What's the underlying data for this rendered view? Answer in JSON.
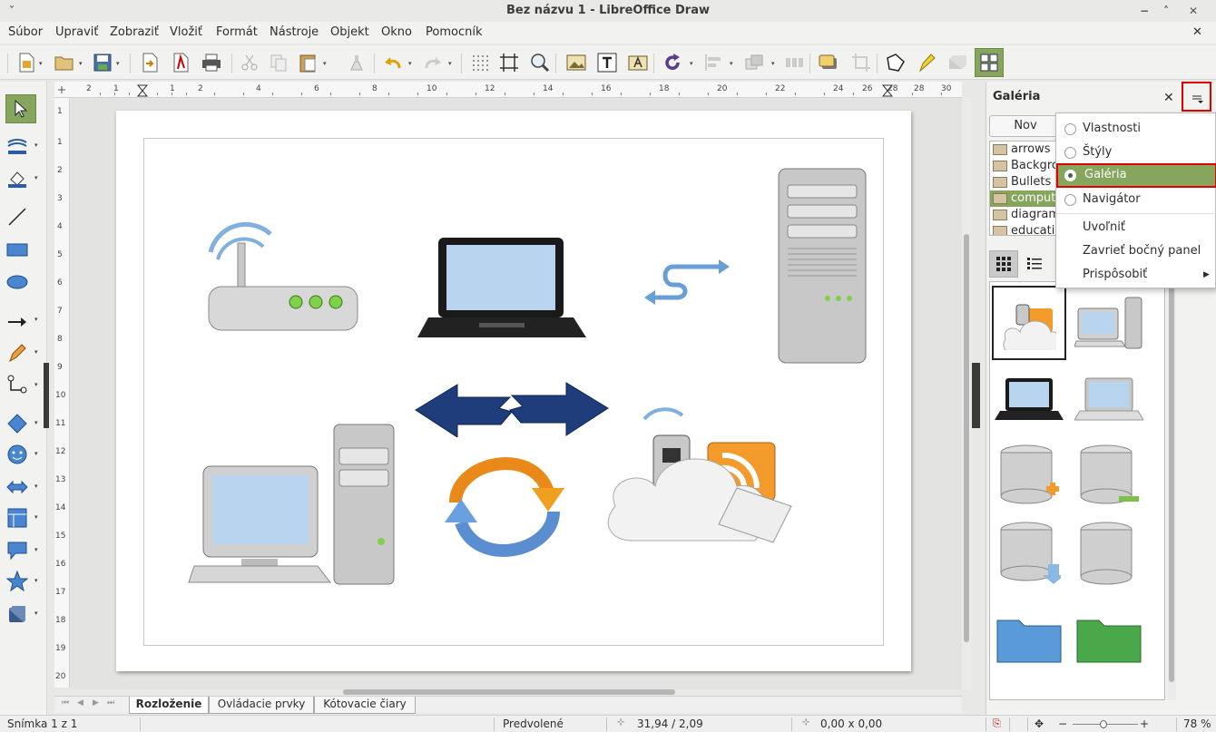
{
  "window": {
    "title": "Bez názvu 1 - LibreOffice Draw",
    "collapse_glyph": "ˇ",
    "minimize_glyph": "−",
    "maximize_glyph": "˄",
    "close_glyph": "✕",
    "doc_close_glyph": "✕"
  },
  "menu": [
    "Súbor",
    "Upraviť",
    "Zobraziť",
    "Vložiť",
    "Formát",
    "Nástroje",
    "Objekt",
    "Okno",
    "Pomocník"
  ],
  "ruler": {
    "h_ticks": [
      "2",
      "1",
      "1",
      "2",
      "4",
      "6",
      "8",
      "10",
      "12",
      "14",
      "16",
      "18",
      "20",
      "22",
      "24",
      "26",
      "28",
      "28",
      "30"
    ],
    "v_ticks": [
      "1",
      "1",
      "2",
      "3",
      "4",
      "5",
      "6",
      "7",
      "8",
      "9",
      "10",
      "11",
      "12",
      "13",
      "14",
      "15",
      "16",
      "17",
      "18",
      "19",
      "20"
    ]
  },
  "tabs": [
    "Rozloženie",
    "Ovládacie prvky",
    "Kótovacie čiary"
  ],
  "status": {
    "slide": "Snímka 1 z 1",
    "master": "Predvolené",
    "position": "31,94 / 2,09",
    "size": "0,00 x 0,00",
    "zoom": "78 %"
  },
  "sidebar": {
    "title": "Galéria",
    "new_button": "Nov",
    "themes": [
      "arrows",
      "Backgro",
      "Bullets",
      "compute",
      "diagram",
      "educatio"
    ],
    "selected_theme": "compute"
  },
  "context_menu": {
    "items": [
      {
        "label": "Vlastnosti",
        "radio": true,
        "selected": false
      },
      {
        "label": "Štýly",
        "radio": true,
        "selected": false
      },
      {
        "label": "Galéria",
        "radio": true,
        "selected": true
      },
      {
        "label": "Navigátor",
        "radio": true,
        "selected": false
      },
      {
        "label": "Uvoľniť",
        "radio": false
      },
      {
        "label": "Zavrieť bočný panel",
        "radio": false
      },
      {
        "label": "Prispôsobiť",
        "radio": false,
        "submenu": true
      }
    ]
  },
  "colors": {
    "accent": "#86a65e",
    "highlight_border": "#e00000",
    "dark_blue": "#1f3d7a",
    "laptop_screen": "#b8d4ef"
  }
}
